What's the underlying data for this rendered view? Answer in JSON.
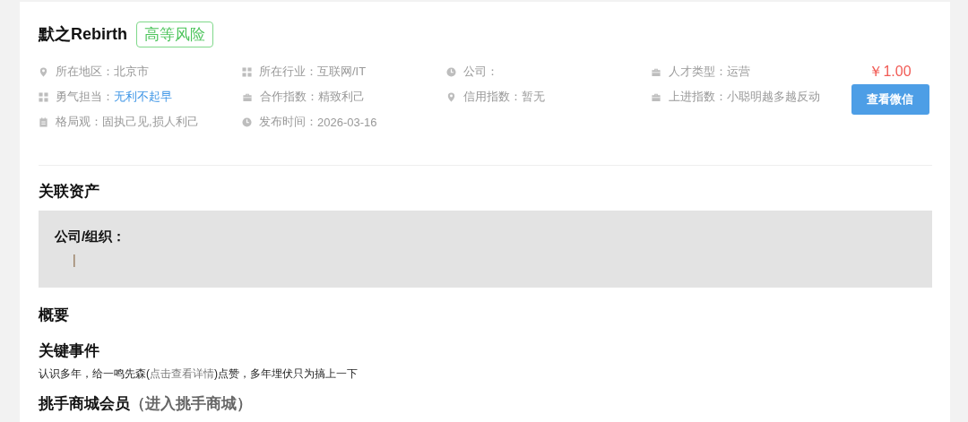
{
  "profile": {
    "name": "默之Rebirth",
    "risk_tag": "高等风险"
  },
  "info": [
    {
      "kind": "pin",
      "label": "所在地区：",
      "value": "北京市",
      "highlighted": false
    },
    {
      "kind": "grid",
      "label": "所在行业：",
      "value": "互联网/IT",
      "highlighted": false
    },
    {
      "kind": "clock",
      "label": "公司：",
      "highlighted": false
    },
    {
      "kind": "briefcase",
      "label": "人才类型：",
      "value": "运营",
      "highlighted": false
    },
    {
      "kind": "grid",
      "label": "勇气担当：",
      "value": "无利不起早",
      "highlighted": true
    },
    {
      "kind": "briefcase",
      "label": "合作指数：",
      "value": "精致利己",
      "highlighted": false
    },
    {
      "kind": "pin",
      "label": "信用指数：",
      "value": "暂无",
      "highlighted": false
    },
    {
      "kind": "briefcase",
      "label": "上进指数：",
      "value": "小聪明越多越反动",
      "highlighted": false
    },
    {
      "kind": "calendar",
      "label": "格局观：",
      "value": "固执己见,损人利己",
      "highlighted": false
    },
    {
      "kind": "clock",
      "label": "发布时间：",
      "value": "2026-03-16",
      "highlighted": false
    }
  ],
  "price": "￥1.00",
  "button": "查看微信",
  "assets": {
    "heading": "关联资产",
    "label": "公司/组织：",
    "value": "|"
  },
  "summary": {
    "heading": "概要"
  },
  "key_event": {
    "heading": "关键事件",
    "text_before": "认识多年，给一鸣先森(",
    "link": "点击查看详情",
    "text_after": ")点赞，多年埋伏只为搞上一下"
  },
  "membership": {
    "heading": "挑手商城会员",
    "link": "（进入挑手商城）"
  }
}
